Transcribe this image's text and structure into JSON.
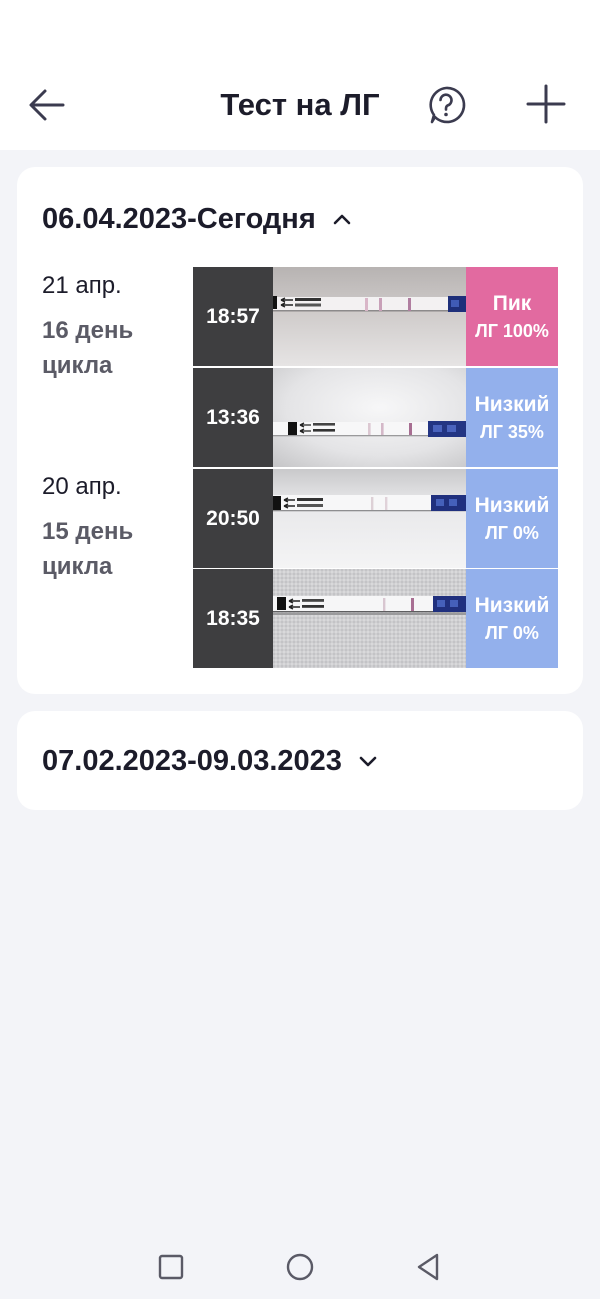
{
  "header": {
    "title": "Тест на ЛГ"
  },
  "icons": {
    "back": "arrow-left-icon",
    "help": "question-circle-icon",
    "add": "plus-icon"
  },
  "colors": {
    "accent_dark": "#1c1c2a",
    "peak": "#e26aa0",
    "low": "#93b0ec",
    "time_bg": "#3e3e40",
    "background": "#f3f4f8"
  },
  "cycles": [
    {
      "range": "06.04.2023-Сегодня",
      "expanded": true,
      "days": [
        {
          "date": "21 апр.",
          "cycle_day": "16 день цикла",
          "tests": [
            {
              "time": "18:57",
              "level": "Пик",
              "value": "ЛГ 100%"
            },
            {
              "time": "13:36",
              "level": "Низкий",
              "value": "ЛГ 35%"
            }
          ]
        },
        {
          "date": "20 апр.",
          "cycle_day": "15 день цикла",
          "tests": [
            {
              "time": "20:50",
              "level": "Низкий",
              "value": "ЛГ 0%"
            },
            {
              "time": "18:35",
              "level": "Низкий",
              "value": "ЛГ 0%"
            }
          ]
        }
      ]
    },
    {
      "range": "07.02.2023-09.03.2023",
      "expanded": false
    }
  ],
  "navigation": {
    "recents": "square-icon",
    "home": "circle-icon",
    "back": "triangle-left-icon"
  }
}
